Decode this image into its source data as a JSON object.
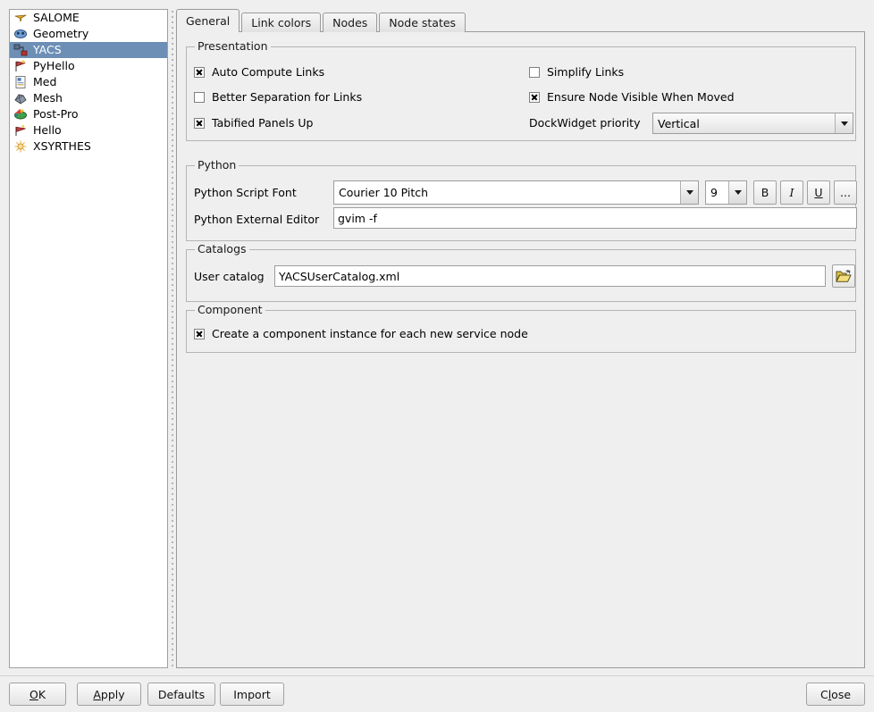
{
  "sidebar": {
    "items": [
      {
        "label": "SALOME",
        "icon": "salome-module-icon",
        "selected": false
      },
      {
        "label": "Geometry",
        "icon": "geometry-module-icon",
        "selected": false
      },
      {
        "label": "YACS",
        "icon": "yacs-module-icon",
        "selected": true
      },
      {
        "label": "PyHello",
        "icon": "pyhello-module-icon",
        "selected": false
      },
      {
        "label": "Med",
        "icon": "med-module-icon",
        "selected": false
      },
      {
        "label": "Mesh",
        "icon": "mesh-module-icon",
        "selected": false
      },
      {
        "label": "Post-Pro",
        "icon": "postpro-module-icon",
        "selected": false
      },
      {
        "label": "Hello",
        "icon": "hello-module-icon",
        "selected": false
      },
      {
        "label": "XSYRTHES",
        "icon": "xsyrthes-module-icon",
        "selected": false
      }
    ]
  },
  "tabs": [
    {
      "label": "General",
      "active": true
    },
    {
      "label": "Link colors",
      "active": false
    },
    {
      "label": "Nodes",
      "active": false
    },
    {
      "label": "Node states",
      "active": false
    }
  ],
  "presentation": {
    "title": "Presentation",
    "auto_compute_links": {
      "label": "Auto Compute Links",
      "checked": true
    },
    "better_separation": {
      "label": "Better Separation for Links",
      "checked": false
    },
    "tabified_panels_up": {
      "label": "Tabified Panels Up",
      "checked": true
    },
    "simplify_links": {
      "label": "Simplify Links",
      "checked": false
    },
    "ensure_node_visible": {
      "label": "Ensure Node Visible When Moved",
      "checked": true
    },
    "dockwidget_priority": {
      "label": "DockWidget priority",
      "value": "Vertical"
    }
  },
  "python": {
    "title": "Python",
    "script_font_label": "Python Script Font",
    "script_font_value": "Courier 10 Pitch",
    "font_size_value": "9",
    "bold_label": "B",
    "italic_label": "I",
    "underline_label": "U",
    "more_label": "...",
    "external_editor_label": "Python External Editor",
    "external_editor_value": "gvim -f"
  },
  "catalogs": {
    "title": "Catalogs",
    "user_catalog_label": "User catalog",
    "user_catalog_value": "YACSUserCatalog.xml",
    "browse_icon": "open-folder-icon"
  },
  "component": {
    "title": "Component",
    "create_instance": {
      "label": "Create a component instance for each new service node",
      "checked": true
    }
  },
  "buttons": {
    "ok": {
      "pre": "",
      "mnemonic": "O",
      "post": "K"
    },
    "apply": {
      "pre": "",
      "mnemonic": "A",
      "post": "pply"
    },
    "defaults": {
      "label": "Defaults"
    },
    "import": {
      "label": "Import"
    },
    "close": {
      "pre": "C",
      "mnemonic": "l",
      "post": "ose"
    }
  },
  "colors": {
    "selection": "#6d8fb5",
    "window": "#efefef",
    "field": "#ffffff",
    "border": "#9d9d9d"
  }
}
